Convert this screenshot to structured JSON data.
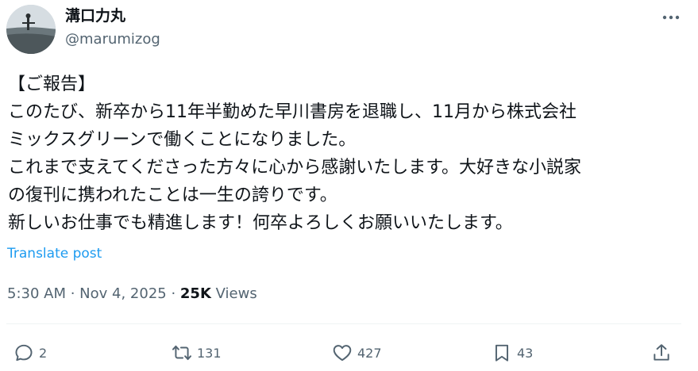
{
  "author": {
    "name": "溝口力丸",
    "handle": "@marumizog"
  },
  "post": {
    "lines": [
      "【ご報告】",
      "このたび、新卒から11年半勤めた早川書房を退職し、11月から株式会社",
      "ミックスグリーンで働くことになりました。",
      "これまで支えてくださった方々に心から感謝いたします。大好きな小説家",
      "の復刊に携われたことは一生の誇りです。",
      "新しいお仕事でも精進します！何卒よろしくお願いいたします。"
    ],
    "translate_label": "Translate post"
  },
  "meta": {
    "time": "5:30 AM",
    "sep1": " · ",
    "date": "Nov 4, 2025",
    "sep2": " · ",
    "views_count": "25K",
    "views_label": " Views"
  },
  "actions": {
    "replies": "2",
    "reposts": "131",
    "likes": "427",
    "bookmarks": "43"
  },
  "colors": {
    "accent": "#1d9bf0",
    "secondary_text": "#536471",
    "primary_text": "#0f1419"
  },
  "icons": [
    "more-icon",
    "reply-icon",
    "repost-icon",
    "like-icon",
    "bookmark-icon",
    "share-icon"
  ]
}
